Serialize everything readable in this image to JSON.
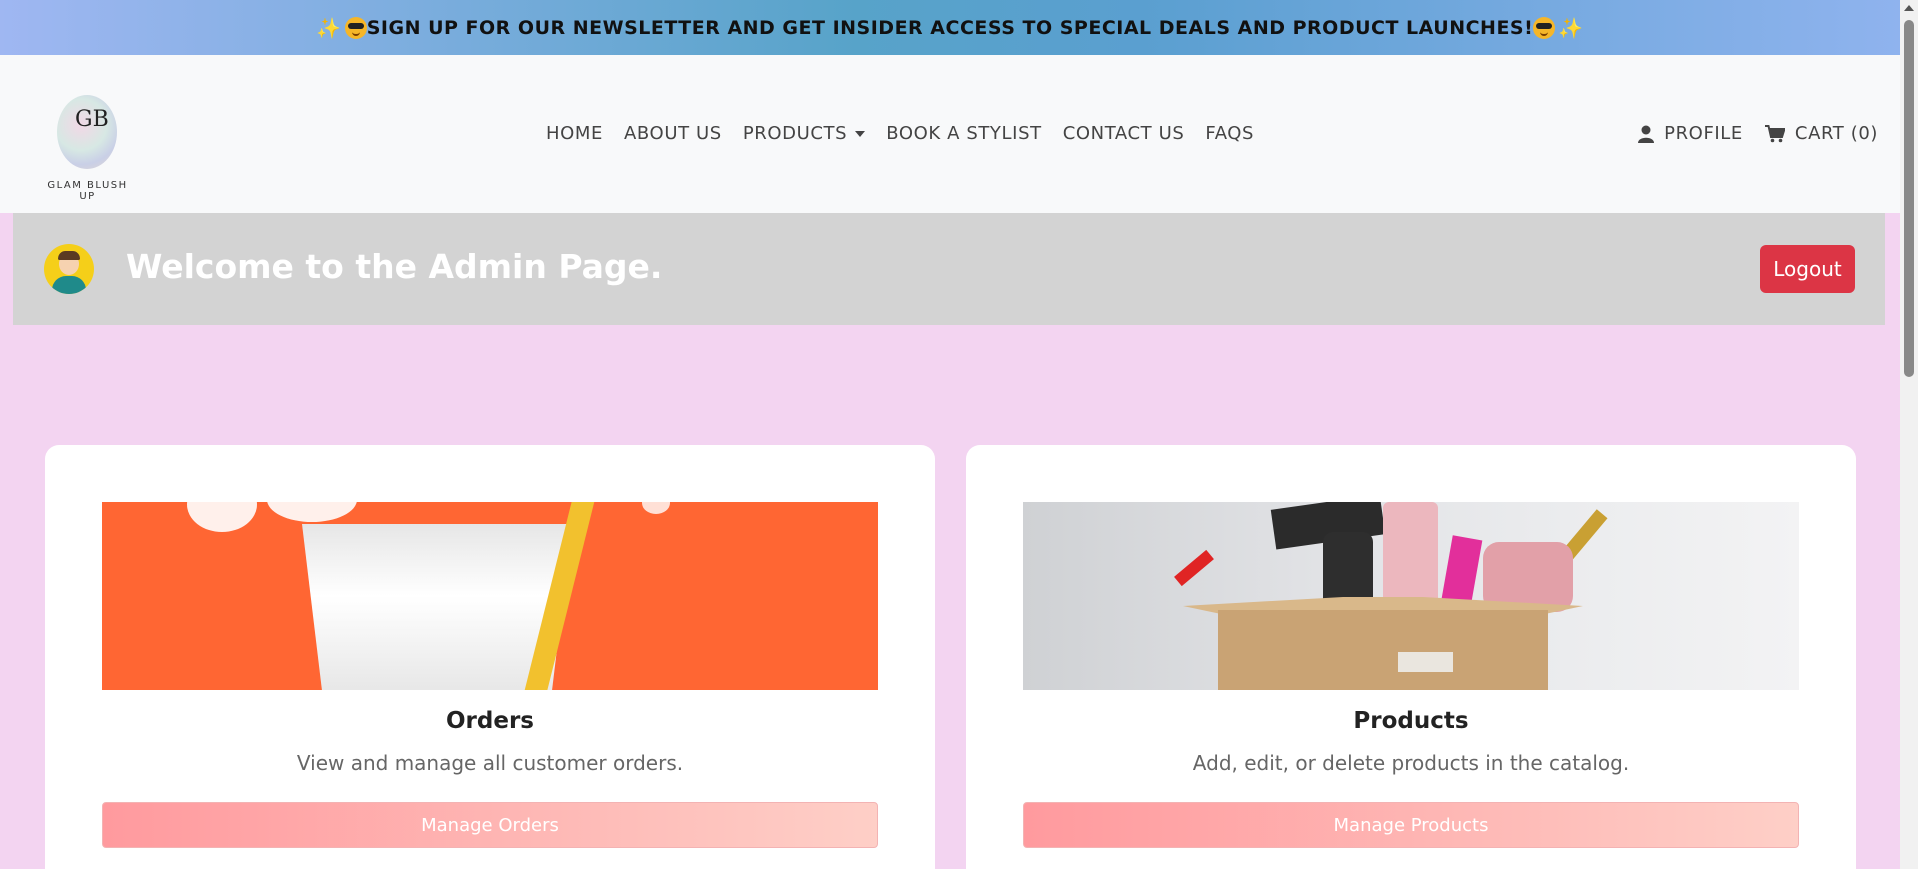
{
  "banner": {
    "text": "SIGN UP FOR OUR NEWSLETTER AND GET INSIDER ACCESS TO SPECIAL DEALS AND PRODUCT LAUNCHES!",
    "left_icons": [
      "sparkles-icon",
      "sunglasses-face-icon"
    ],
    "right_icons": [
      "sunglasses-face-icon",
      "sparkles-icon"
    ]
  },
  "brand": {
    "monogram": "GB",
    "name": "GLAM BLUSH UP"
  },
  "nav": {
    "links": [
      "HOME",
      "ABOUT US",
      "PRODUCTS",
      "BOOK A STYLIST",
      "CONTACT US",
      "FAQS"
    ],
    "profile": "PROFILE",
    "cart": "CART (0)"
  },
  "admin": {
    "title": "Welcome to the Admin Page.",
    "logout": "Logout"
  },
  "cards": [
    {
      "title": "Orders",
      "description": "View and manage all customer orders.",
      "button": "Manage Orders"
    },
    {
      "title": "Products",
      "description": "Add, edit, or delete products in the catalog.",
      "button": "Manage Products"
    }
  ],
  "colors": {
    "page_bg": "#f3d4f1",
    "navbar_bg": "#f8f9fa",
    "admin_bar_bg": "#d3d3d3",
    "logout_red": "#dc3545",
    "button_gradient_start": "#ff9a9e",
    "button_gradient_end": "#fecfc7"
  }
}
